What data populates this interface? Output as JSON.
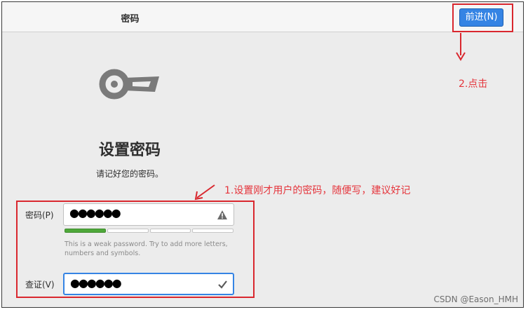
{
  "header": {
    "title": "密码",
    "next_label": "前进(N)"
  },
  "main": {
    "title": "设置密码",
    "subtitle": "请记好您的密码。"
  },
  "form": {
    "password_label": "密码(P)",
    "password_value": "●●●●●●",
    "strength_hint": "This is a weak password. Try to add more letters, numbers and symbols.",
    "strength_level": 0.25,
    "confirm_label": "查证(V)",
    "confirm_value": "●●●●●●"
  },
  "annotations": {
    "step1": "1.设置刚才用户的密码，随便写，建议好记",
    "step2": "2.点击"
  },
  "watermark": "CSDN @Eason_HMH",
  "colors": {
    "accent": "#3584e4",
    "annotation": "#d9272e",
    "strength": "#4ea83a"
  },
  "icons": [
    "key-icon",
    "warning-icon",
    "check-icon"
  ]
}
